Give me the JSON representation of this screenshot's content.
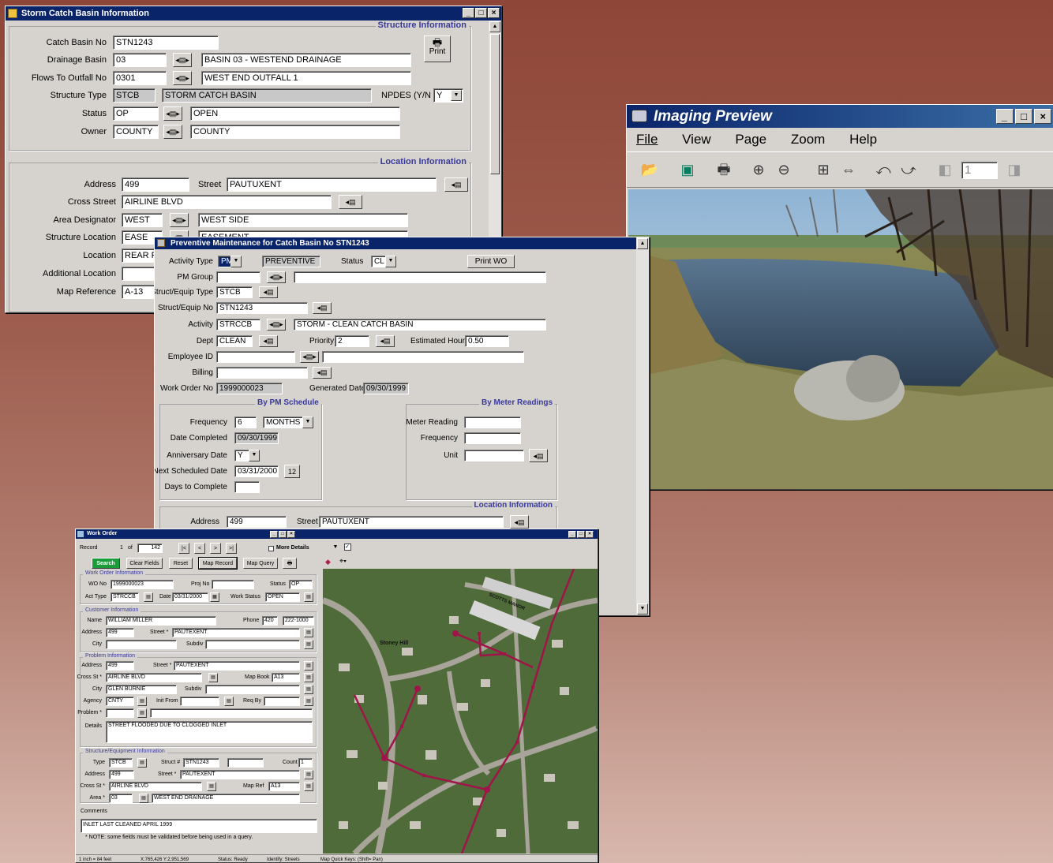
{
  "storm": {
    "title": "Storm Catch Basin Information",
    "print_label": "Print",
    "structure_info_title": "Structure Information",
    "location_info_title": "Location Information",
    "catch_basin_no": {
      "label": "Catch Basin No",
      "value": "STN1243"
    },
    "drainage_basin": {
      "label": "Drainage Basin",
      "value": "03",
      "desc": "BASIN 03 - WESTEND DRAINAGE"
    },
    "flows_to_outfall": {
      "label": "Flows To Outfall No",
      "value": "0301",
      "desc": "WEST END OUTFALL 1"
    },
    "structure_type": {
      "label": "Structure Type",
      "value": "STCB",
      "desc": "STORM CATCH BASIN"
    },
    "npdes": {
      "label": "NPDES (Y/N",
      "value": "Y"
    },
    "status": {
      "label": "Status",
      "value": "OP",
      "desc": "OPEN"
    },
    "owner": {
      "label": "Owner",
      "value": "COUNTY",
      "desc": "COUNTY"
    },
    "address": {
      "label": "Address",
      "value": "499"
    },
    "street": {
      "label": "Street",
      "value": "PAUTUXENT"
    },
    "cross_street": {
      "label": "Cross Street",
      "value": "AIRLINE BLVD"
    },
    "area_designator": {
      "label": "Area Designator",
      "value": "WEST",
      "desc": "WEST SIDE"
    },
    "structure_location": {
      "label": "Structure Location",
      "value": "EASE",
      "desc": "EASEMENT"
    },
    "location": {
      "label": "Location",
      "value": "REAR P"
    },
    "additional_location": {
      "label": "Additional Location",
      "value": ""
    },
    "map_reference": {
      "label": "Map Reference",
      "value": "A-13"
    }
  },
  "pm": {
    "title": "Preventive Maintenance for Catch Basin No STN1243",
    "activity_type": {
      "label": "Activity Type",
      "value": "PM",
      "desc": "PREVENTIVE"
    },
    "status": {
      "label": "Status",
      "value": "CL"
    },
    "print_wo": "Print WO",
    "pm_group": {
      "label": "PM Group",
      "value": ""
    },
    "struct_equip_type": {
      "label": "Struct/Equip Type",
      "value": "STCB"
    },
    "struct_equip_no": {
      "label": "Struct/Equip No",
      "value": "STN1243"
    },
    "activity": {
      "label": "Activity",
      "value": "STRCCB",
      "desc": "STORM - CLEAN CATCH BASIN"
    },
    "dept": {
      "label": "Dept",
      "value": "CLEAN"
    },
    "priority": {
      "label": "Priority",
      "value": "2"
    },
    "est_hours": {
      "label": "Estimated Hours",
      "value": "0.50"
    },
    "employee_id": {
      "label": "Employee ID",
      "value": ""
    },
    "billing": {
      "label": "Billing",
      "value": ""
    },
    "work_order_no": {
      "label": "Work Order No",
      "value": "1999000023"
    },
    "generated_date": {
      "label": "Generated Date",
      "value": "09/30/1999"
    },
    "by_pm_schedule": "By PM Schedule",
    "by_meter_readings": "By Meter Readings",
    "frequency": {
      "label": "Frequency",
      "value": "6",
      "unit": "MONTHS"
    },
    "date_completed": {
      "label": "Date Completed",
      "value": "09/30/1999"
    },
    "anniversary_date": {
      "label": "Anniversary Date",
      "value": "Y"
    },
    "next_scheduled": {
      "label": "Next Scheduled Date",
      "value": "03/31/2000"
    },
    "days_to_complete": {
      "label": "Days to Complete",
      "value": ""
    },
    "meter_reading": {
      "label": "Meter Reading",
      "value": ""
    },
    "meter_frequency": {
      "label": "Frequency",
      "value": ""
    },
    "unit": {
      "label": "Unit",
      "value": ""
    },
    "location_info_title": "Location Information",
    "address": {
      "label": "Address",
      "value": "499"
    },
    "street": {
      "label": "Street",
      "value": "PAUTUXENT"
    }
  },
  "imaging": {
    "title": "Imaging Preview",
    "menu": [
      "File",
      "View",
      "Page",
      "Zoom",
      "Help"
    ],
    "page_number": "1"
  },
  "wo": {
    "title": "Work Order",
    "record_label": "Record",
    "record_current": "1",
    "record_of": "of",
    "record_total": "142",
    "nav": [
      "|<",
      "<",
      ">",
      ">|"
    ],
    "more_details": "More Details",
    "buttons": [
      "Search",
      "Clear Fields",
      "Reset",
      "Map Record",
      "Map Query"
    ],
    "sections": {
      "work_order": "Work Order Information",
      "customer": "Customer Information",
      "problem": "Problem Information",
      "structure": "Structure/Equipment Information"
    },
    "wo_no": {
      "label": "WO No",
      "value": "1999000023"
    },
    "proj_no": {
      "label": "Proj No",
      "value": ""
    },
    "status": {
      "label": "Status",
      "value": "OP"
    },
    "act_type": {
      "label": "Act Type",
      "value": "STRCCB"
    },
    "date": {
      "label": "Date",
      "value": "03/31/2000"
    },
    "work_status": {
      "label": "Work Status",
      "value": "OPEN"
    },
    "name": {
      "label": "Name",
      "value": "WILLIAM MILLER"
    },
    "phone": {
      "label": "Phone",
      "area": "420",
      "number": "222-1000"
    },
    "cust_address": {
      "label": "Address",
      "value": "499"
    },
    "cust_street": {
      "label": "Street *",
      "value": "PAUTEXENT"
    },
    "cust_city": {
      "label": "City",
      "value": ""
    },
    "cust_subdiv": {
      "label": "Subdiv",
      "value": ""
    },
    "prob_address": {
      "label": "Address",
      "value": "499"
    },
    "prob_street": {
      "label": "Street *",
      "value": "PAUTEXENT"
    },
    "cross_st": {
      "label": "Cross St *",
      "value": "AIRLINE BLVD"
    },
    "map_book": {
      "label": "Map Book",
      "value": "A13"
    },
    "prob_city": {
      "label": "City",
      "value": "GLEN BURNIE"
    },
    "prob_subdiv": {
      "label": "Subdiv",
      "value": ""
    },
    "agency": {
      "label": "Agency",
      "value": "CNTY"
    },
    "init_from": {
      "label": "Init From",
      "value": ""
    },
    "req_by": {
      "label": "Req By",
      "value": ""
    },
    "problem": {
      "label": "Problem *",
      "value": ""
    },
    "details": {
      "label": "Details",
      "value": "STREET FLOODED DUE TO CLOGGED INLET"
    },
    "se_type": {
      "label": "Type",
      "value": "STCB"
    },
    "struct_no": {
      "label": "Struct #",
      "value": "STN1243"
    },
    "count": {
      "label": "Count",
      "value": "1"
    },
    "se_address": {
      "label": "Address",
      "value": "499"
    },
    "se_street": {
      "label": "Street *",
      "value": "PAUTEXENT"
    },
    "se_cross": {
      "label": "Cross St *",
      "value": "AIRLINE BLVD"
    },
    "map_ref": {
      "label": "Map Ref",
      "value": "A13"
    },
    "area": {
      "label": "Area *",
      "value": "03",
      "desc": "WEST END DRAINAGE"
    },
    "comments_label": "Comments",
    "comments": "INLET LAST CLEANED APRIL 1999",
    "note": "* NOTE: some fields must be validated before being used in a query.",
    "map_label": "Stoney Hill",
    "map_label2": "SCOTTS MANOR",
    "status_bar": [
      "1 inch = 84 feet",
      "X:765,426  Y:2,951,569",
      "Status: Ready",
      "Identify: Streets",
      "Map Quick Keys: (Shift= Pan)"
    ]
  }
}
